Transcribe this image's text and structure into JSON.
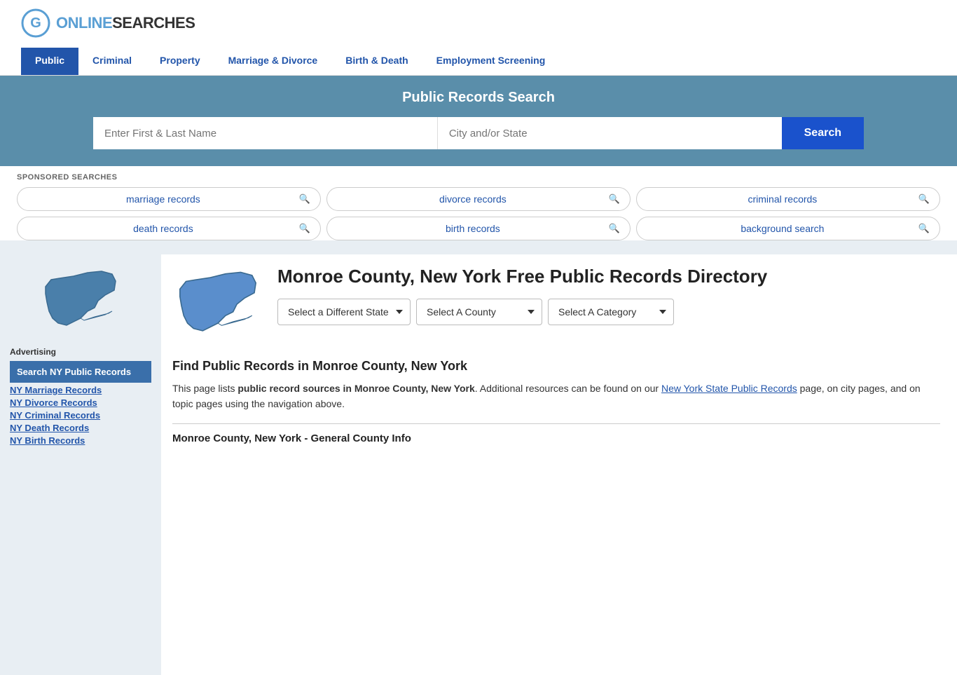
{
  "header": {
    "logo": {
      "online": "ONLINE",
      "searches": "SEARCHES"
    },
    "nav": [
      {
        "label": "Public",
        "active": true
      },
      {
        "label": "Criminal",
        "active": false
      },
      {
        "label": "Property",
        "active": false
      },
      {
        "label": "Marriage & Divorce",
        "active": false
      },
      {
        "label": "Birth & Death",
        "active": false
      },
      {
        "label": "Employment Screening",
        "active": false
      }
    ]
  },
  "hero": {
    "title": "Public Records Search",
    "name_placeholder": "Enter First & Last Name",
    "location_placeholder": "City and/or State",
    "search_button": "Search"
  },
  "sponsored": {
    "label": "SPONSORED SEARCHES",
    "pills": [
      {
        "text": "marriage records"
      },
      {
        "text": "divorce records"
      },
      {
        "text": "criminal records"
      },
      {
        "text": "death records"
      },
      {
        "text": "birth records"
      },
      {
        "text": "background search"
      }
    ]
  },
  "sidebar": {
    "advertising_label": "Advertising",
    "ad_link": "Search NY Public Records",
    "links": [
      "NY Marriage Records",
      "NY Divorce Records",
      "NY Criminal Records",
      "NY Death Records",
      "NY Birth Records"
    ]
  },
  "page": {
    "title": "Monroe County, New York Free Public Records Directory",
    "dropdowns": {
      "state": "Select a Different State",
      "county": "Select A County",
      "category": "Select A Category"
    },
    "find_title": "Find Public Records in Monroe County, New York",
    "find_text_1": "This page lists ",
    "find_bold": "public record sources in Monroe County, New York",
    "find_text_2": ". Additional resources can be found on our ",
    "find_link": "New York State Public Records",
    "find_text_3": " page, on city pages, and on topic pages using the navigation above.",
    "general_info": "Monroe County, New York - General County Info"
  }
}
